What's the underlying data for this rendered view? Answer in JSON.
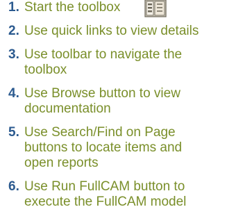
{
  "colors": {
    "step_number": "#2b5a8f",
    "step_text": "#7a8f2a"
  },
  "steps": [
    {
      "number": "1.",
      "lines": [
        "Start the toolbox"
      ],
      "icon": "toolbox-icon"
    },
    {
      "number": "2.",
      "lines": [
        "Use quick links to view details"
      ]
    },
    {
      "number": "3.",
      "lines": [
        "Use toolbar to navigate the",
        "toolbox"
      ]
    },
    {
      "number": "4.",
      "lines": [
        "Use Browse button to view",
        "documentation"
      ]
    },
    {
      "number": "5.",
      "lines": [
        "Use Search/Find on Page",
        "buttons to locate items and",
        "open reports"
      ]
    },
    {
      "number": "6.",
      "lines": [
        "Use Run FullCAM button to",
        "execute the FullCAM model"
      ]
    }
  ]
}
